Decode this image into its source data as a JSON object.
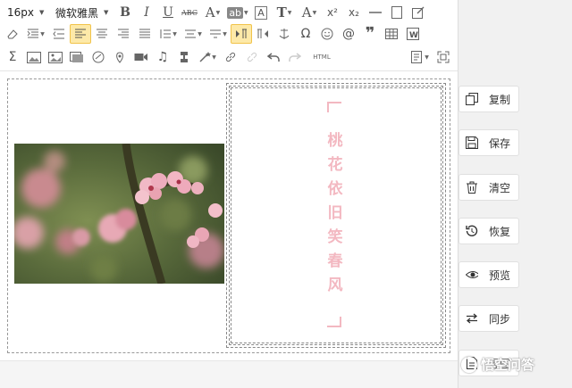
{
  "toolbar": {
    "font_size": "16px",
    "font_family": "微软雅黑",
    "row1_icons": [
      "bold-icon",
      "italic-icon",
      "underline-icon",
      "strikethrough-icon",
      "font-color-icon",
      "highlight-icon",
      "border-text-icon",
      "text-style-icon",
      "clear-format-icon",
      "superscript-icon",
      "subscript-icon",
      "horizontal-rule-icon",
      "blank-page-icon",
      "external-edit-icon"
    ],
    "bold": "B",
    "italic": "I",
    "underline": "U",
    "strikethrough": "ABC",
    "font_color": "A",
    "highlight": "ab",
    "border_text": "A",
    "text_style": "T",
    "clear_format": "A",
    "superscript": "x²",
    "subscript": "x₂",
    "omega": "Ω",
    "html": "HTML"
  },
  "side_buttons": [
    {
      "label": "复制",
      "icon": "copy-icon"
    },
    {
      "label": "保存",
      "icon": "save-icon"
    },
    {
      "label": "清空",
      "icon": "trash-icon"
    },
    {
      "label": "恢复",
      "icon": "restore-icon"
    },
    {
      "label": "预览",
      "icon": "eye-icon"
    },
    {
      "label": "同步",
      "icon": "sync-icon"
    }
  ],
  "bottom_partial_button": {
    "label": "导图",
    "icon": "document-icon"
  },
  "poem": {
    "chars": [
      "桃",
      "花",
      "依",
      "旧",
      "笑",
      "春",
      "风"
    ]
  },
  "watermark": {
    "text": "悟空问答"
  },
  "colors": {
    "poem_pink": "#f3b8c1",
    "active_button": "#fde9a8",
    "panel_gray": "#f1f1f1"
  }
}
